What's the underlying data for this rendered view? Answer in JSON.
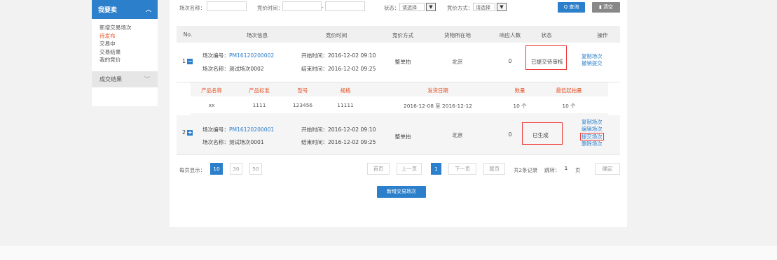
{
  "sidebar": {
    "header": "我要卖",
    "items": [
      {
        "label": "新增交易场次",
        "active": false
      },
      {
        "label": "待发布",
        "active": true
      },
      {
        "label": "交易中",
        "active": false
      },
      {
        "label": "交易结果",
        "active": false
      },
      {
        "label": "我的竞价",
        "active": false
      }
    ],
    "group2": "成交结果"
  },
  "filters": {
    "session_name_label": "场次名称：",
    "bid_time_label": "竞价时间：",
    "range_sep": "-",
    "status_label": "状态：",
    "status_value": "请选择",
    "bid_method_label": "竞价方式：",
    "bid_method_value": "请选择",
    "query_label": "Q 查询",
    "clear_label": "清空"
  },
  "table": {
    "headers": [
      "No.",
      "场次信息",
      "竞价时间",
      "竞价方式",
      "货物所在地",
      "响应人数",
      "状态",
      "操作"
    ],
    "rows": [
      {
        "no": "1",
        "code_label": "场次编号：",
        "code": "PM16120200002",
        "name": "场次名称：测试场次0002",
        "start": "开始时间：2016-12-02 09:10",
        "end": "结束时间：2016-12-02 09:25",
        "method": "整单拍",
        "location": "北京",
        "responders": "0",
        "status": "已提交待审核",
        "ops": [
          "复制场次",
          "撤销提交"
        ]
      },
      {
        "no": "2",
        "code_label": "场次编号：",
        "code": "PM16120200001",
        "name": "场次名称：测试场次0001",
        "start": "开始时间：2016-12-02 09:10",
        "end": "结束时间：2016-12-02 09:25",
        "method": "整单拍",
        "location": "北京",
        "responders": "0",
        "status": "已生成",
        "ops": [
          "复制场次",
          "编辑场次",
          "提交场次",
          "删除场次"
        ]
      }
    ]
  },
  "subtable": {
    "headers": [
      "产品名称",
      "产品标准",
      "型号",
      "规格",
      "发货日期",
      "数量",
      "最低起拍量"
    ],
    "row": [
      "xx",
      "1111",
      "123456",
      "11111",
      "2016-12-08 至 2016-12-12",
      "10 个",
      "10 个"
    ]
  },
  "pager": {
    "per_page_label": "每页显示：",
    "sizes": [
      "10",
      "30",
      "50"
    ],
    "first": "首页",
    "prev": "上一页",
    "current": "1",
    "next": "下一页",
    "last": "尾页",
    "total": "共2条记录",
    "jump_label": "跳转：",
    "jump_value": "1",
    "page_unit": "页",
    "confirm": "确定"
  },
  "new_session_button": "新增交易场次",
  "colors": {
    "accent": "#2c7fca",
    "highlight": "#e6542a",
    "annotation": "#e33333"
  }
}
